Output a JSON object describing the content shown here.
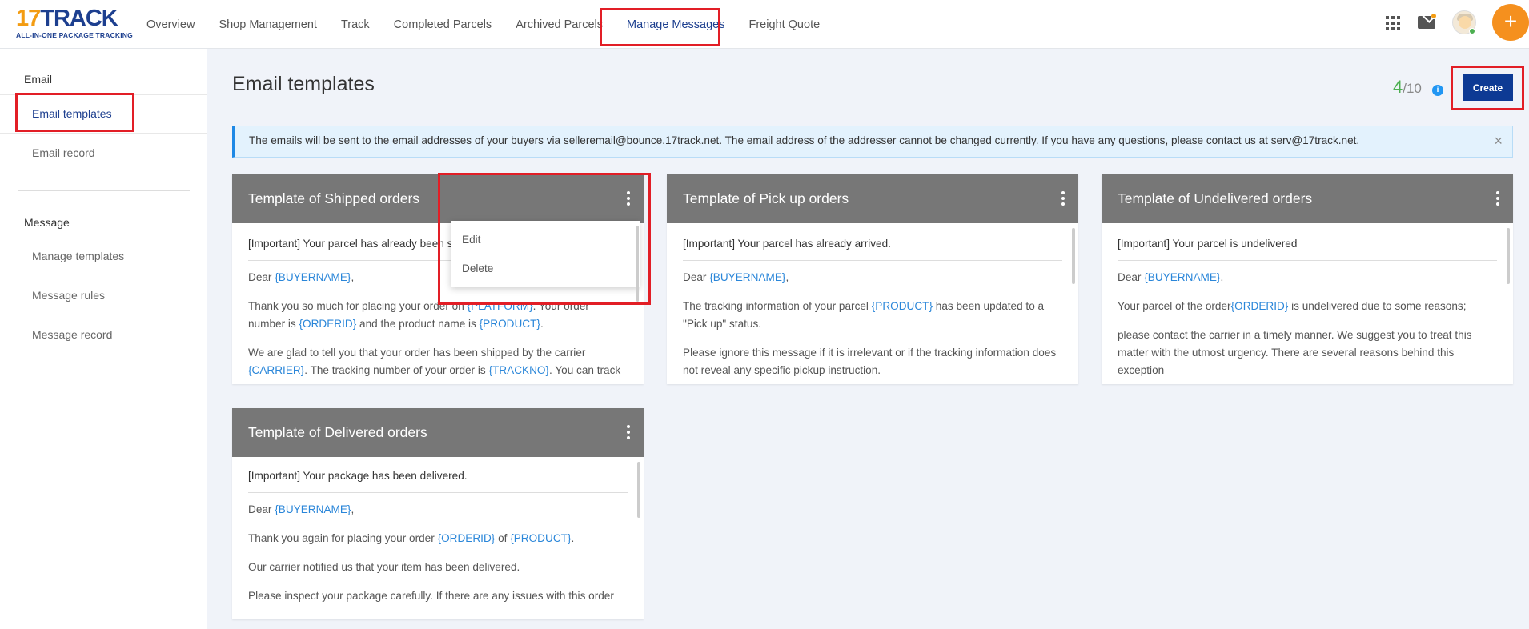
{
  "header": {
    "logo_main_num": "17",
    "logo_main_text": "TRACK",
    "logo_sub": "ALL-IN-ONE PACKAGE TRACKING",
    "nav": [
      {
        "label": "Overview"
      },
      {
        "label": "Shop Management"
      },
      {
        "label": "Track"
      },
      {
        "label": "Completed Parcels"
      },
      {
        "label": "Archived Parcels"
      },
      {
        "label": "Manage Messages",
        "active": true
      },
      {
        "label": "Freight Quote"
      }
    ],
    "icons": [
      "apps-grid-icon",
      "mail-icon",
      "avatar",
      "plus-icon"
    ],
    "plus_label": "+"
  },
  "sidebar": {
    "email_head": "Email",
    "email_items": [
      {
        "label": "Email templates",
        "active": true
      },
      {
        "label": "Email record"
      }
    ],
    "message_head": "Message",
    "message_items": [
      {
        "label": "Manage templates"
      },
      {
        "label": "Message rules"
      },
      {
        "label": "Message record"
      }
    ]
  },
  "main": {
    "title": "Email templates",
    "quota_used": "4",
    "quota_total": "/10",
    "info_icon": "i",
    "create_label": "Create",
    "notice": "The emails will be sent to the email addresses of your buyers via selleremail@bounce.17track.net. The email address of the addresser cannot be changed currently. If you have any questions, please contact us at serv@17track.net.",
    "notice_close": "×"
  },
  "cards": [
    {
      "title": "Template of Shipped orders",
      "subject": "[Important] Your parcel has already been shipped.",
      "dear": "Dear ",
      "p1": [
        "Thank you so much for placing your order on ",
        "{PLATFORM}",
        ". Your order number is ",
        "{ORDERID}",
        " and the product name is ",
        "{PRODUCT}",
        "."
      ],
      "p2": [
        "We are glad to tell you that your order has been shipped by the carrier ",
        "{CARRIER}",
        ". The tracking number of your order is ",
        "{TRACKNO}",
        ". You can track"
      ]
    },
    {
      "title": "Template of Pick up orders",
      "subject": "[Important] Your parcel has already arrived.",
      "dear": "Dear ",
      "p1": [
        "The tracking information of your parcel ",
        "{PRODUCT}",
        " has been updated to a \"Pick up\" status."
      ],
      "p2": [
        "Please ignore this message if it is irrelevant or if the tracking information does not reveal any specific pickup instruction."
      ]
    },
    {
      "title": "Template of Undelivered orders",
      "subject": "[Important] Your parcel is undelivered",
      "dear": "Dear ",
      "p1": [
        "Your parcel of the order",
        "{ORDERID}",
        " is undelivered due to some reasons;"
      ],
      "p2": [
        "please contact the carrier in a timely manner. We suggest you to treat this matter with the utmost urgency. There are several reasons behind this exception"
      ]
    },
    {
      "title": "Template of Delivered orders",
      "subject": "[Important] Your package has been delivered.",
      "dear": "Dear ",
      "p1": [
        "Thank you again for placing your order ",
        "{ORDERID}",
        " of ",
        "{PRODUCT}",
        "."
      ],
      "p2": [
        "Our carrier notified us that your item has been delivered."
      ],
      "p3": [
        "Please inspect your package carefully. If there are any issues with this order"
      ]
    }
  ],
  "buyer_var": "{BUYERNAME}",
  "dropdown": {
    "items": [
      "Edit",
      "Delete"
    ]
  },
  "colors": {
    "brand": "#1d3f8f",
    "accent": "#f5901e",
    "highlight_box": "#e21e26",
    "variable": "#2a86d9",
    "card_header": "#777777"
  }
}
